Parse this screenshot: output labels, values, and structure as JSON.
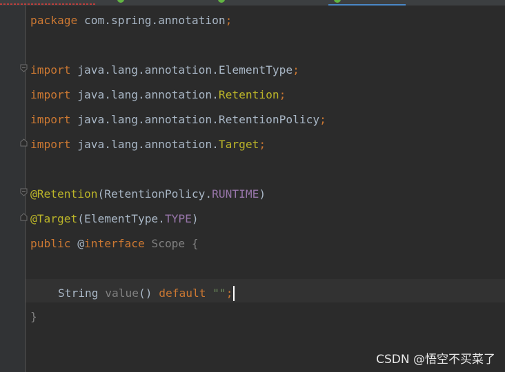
{
  "code": {
    "line1": {
      "kw": "package",
      "rest": " com.spring.annotation",
      "semi": ";"
    },
    "line3": {
      "kw": "import",
      "pkg": " java.lang.annotation.",
      "cls": "ElementType",
      "semi": ";"
    },
    "line4": {
      "kw": "import",
      "pkg": " java.lang.annotation.",
      "cls": "Retention",
      "semi": ";"
    },
    "line5": {
      "kw": "import",
      "pkg": " java.lang.annotation.",
      "cls": "RetentionPolicy",
      "semi": ";"
    },
    "line6": {
      "kw": "import",
      "pkg": " java.lang.annotation.",
      "cls": "Target",
      "semi": ";"
    },
    "line8": {
      "ann": "@Retention",
      "open": "(RetentionPolicy.",
      "const": "RUNTIME",
      "close": ")"
    },
    "line9": {
      "ann": "@Target",
      "open": "(ElementType.",
      "const": "TYPE",
      "close": ")"
    },
    "line10": {
      "kw1": "public",
      "at": " @",
      "kw2": "interface",
      "name": " Scope",
      "brace": " {"
    },
    "line12": {
      "type": "String",
      "method": " value",
      "parens": "()",
      "kw": " default",
      "str": " \"\"",
      "semi": ";"
    },
    "line13": {
      "brace": "}"
    }
  },
  "watermark": "CSDN @悟空不买菜了",
  "colors": {
    "background": "#2b2b2b",
    "keyword": "#cc7832",
    "annotation": "#bbb529",
    "constant": "#9876aa",
    "text": "#a9b7c6"
  }
}
